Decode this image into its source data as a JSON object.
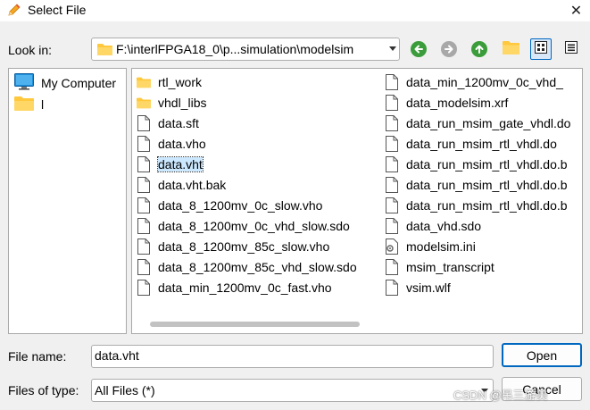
{
  "window": {
    "title": "Select File",
    "close_icon": "close-icon",
    "title_icon": "pencil-icon"
  },
  "look_in": {
    "label": "Look in:",
    "path": "F:\\interlFPGA18_0\\p...simulation\\modelsim"
  },
  "toolbar": {
    "buttons": [
      {
        "name": "back",
        "icon": "back-arrow-icon",
        "color": "#3a9c3a"
      },
      {
        "name": "forward",
        "icon": "forward-arrow-icon",
        "color": "#a8a8a8"
      },
      {
        "name": "up",
        "icon": "up-arrow-icon",
        "color": "#3a9c3a"
      },
      {
        "name": "new-folder",
        "icon": "new-folder-icon",
        "color": "#ffc83d"
      },
      {
        "name": "list-view",
        "icon": "list-view-icon",
        "selected": true
      },
      {
        "name": "detail-view",
        "icon": "detail-view-icon"
      }
    ]
  },
  "sidebar": {
    "items": [
      {
        "label": "My Computer",
        "icon": "computer-icon"
      },
      {
        "label": "l",
        "icon": "folder-icon"
      }
    ]
  },
  "files": {
    "columns": [
      [
        {
          "name": "rtl_work",
          "type": "folder"
        },
        {
          "name": "vhdl_libs",
          "type": "folder"
        },
        {
          "name": "data.sft",
          "type": "file"
        },
        {
          "name": "data.vho",
          "type": "file"
        },
        {
          "name": "data.vht",
          "type": "file",
          "selected": true
        },
        {
          "name": "data.vht.bak",
          "type": "file"
        },
        {
          "name": "data_8_1200mv_0c_slow.vho",
          "type": "file"
        },
        {
          "name": "data_8_1200mv_0c_vhd_slow.sdo",
          "type": "file"
        },
        {
          "name": "data_8_1200mv_85c_slow.vho",
          "type": "file"
        },
        {
          "name": "data_8_1200mv_85c_vhd_slow.sdo",
          "type": "file"
        },
        {
          "name": "data_min_1200mv_0c_fast.vho",
          "type": "file"
        }
      ],
      [
        {
          "name": "data_min_1200mv_0c_vhd_",
          "type": "file"
        },
        {
          "name": "data_modelsim.xrf",
          "type": "file"
        },
        {
          "name": "data_run_msim_gate_vhdl.do",
          "type": "file"
        },
        {
          "name": "data_run_msim_rtl_vhdl.do",
          "type": "file"
        },
        {
          "name": "data_run_msim_rtl_vhdl.do.b",
          "type": "file"
        },
        {
          "name": "data_run_msim_rtl_vhdl.do.b",
          "type": "file"
        },
        {
          "name": "data_run_msim_rtl_vhdl.do.b",
          "type": "file"
        },
        {
          "name": "data_vhd.sdo",
          "type": "file"
        },
        {
          "name": "modelsim.ini",
          "type": "settings"
        },
        {
          "name": "msim_transcript",
          "type": "file"
        },
        {
          "name": "vsim.wlf",
          "type": "file"
        }
      ]
    ]
  },
  "file_name": {
    "label": "File name:",
    "value": "data.vht"
  },
  "file_type": {
    "label": "Files of type:",
    "value": "All Files (*)"
  },
  "buttons": {
    "open": "Open",
    "cancel": "Cancel"
  },
  "watermark": "CSDN @吊三游美"
}
